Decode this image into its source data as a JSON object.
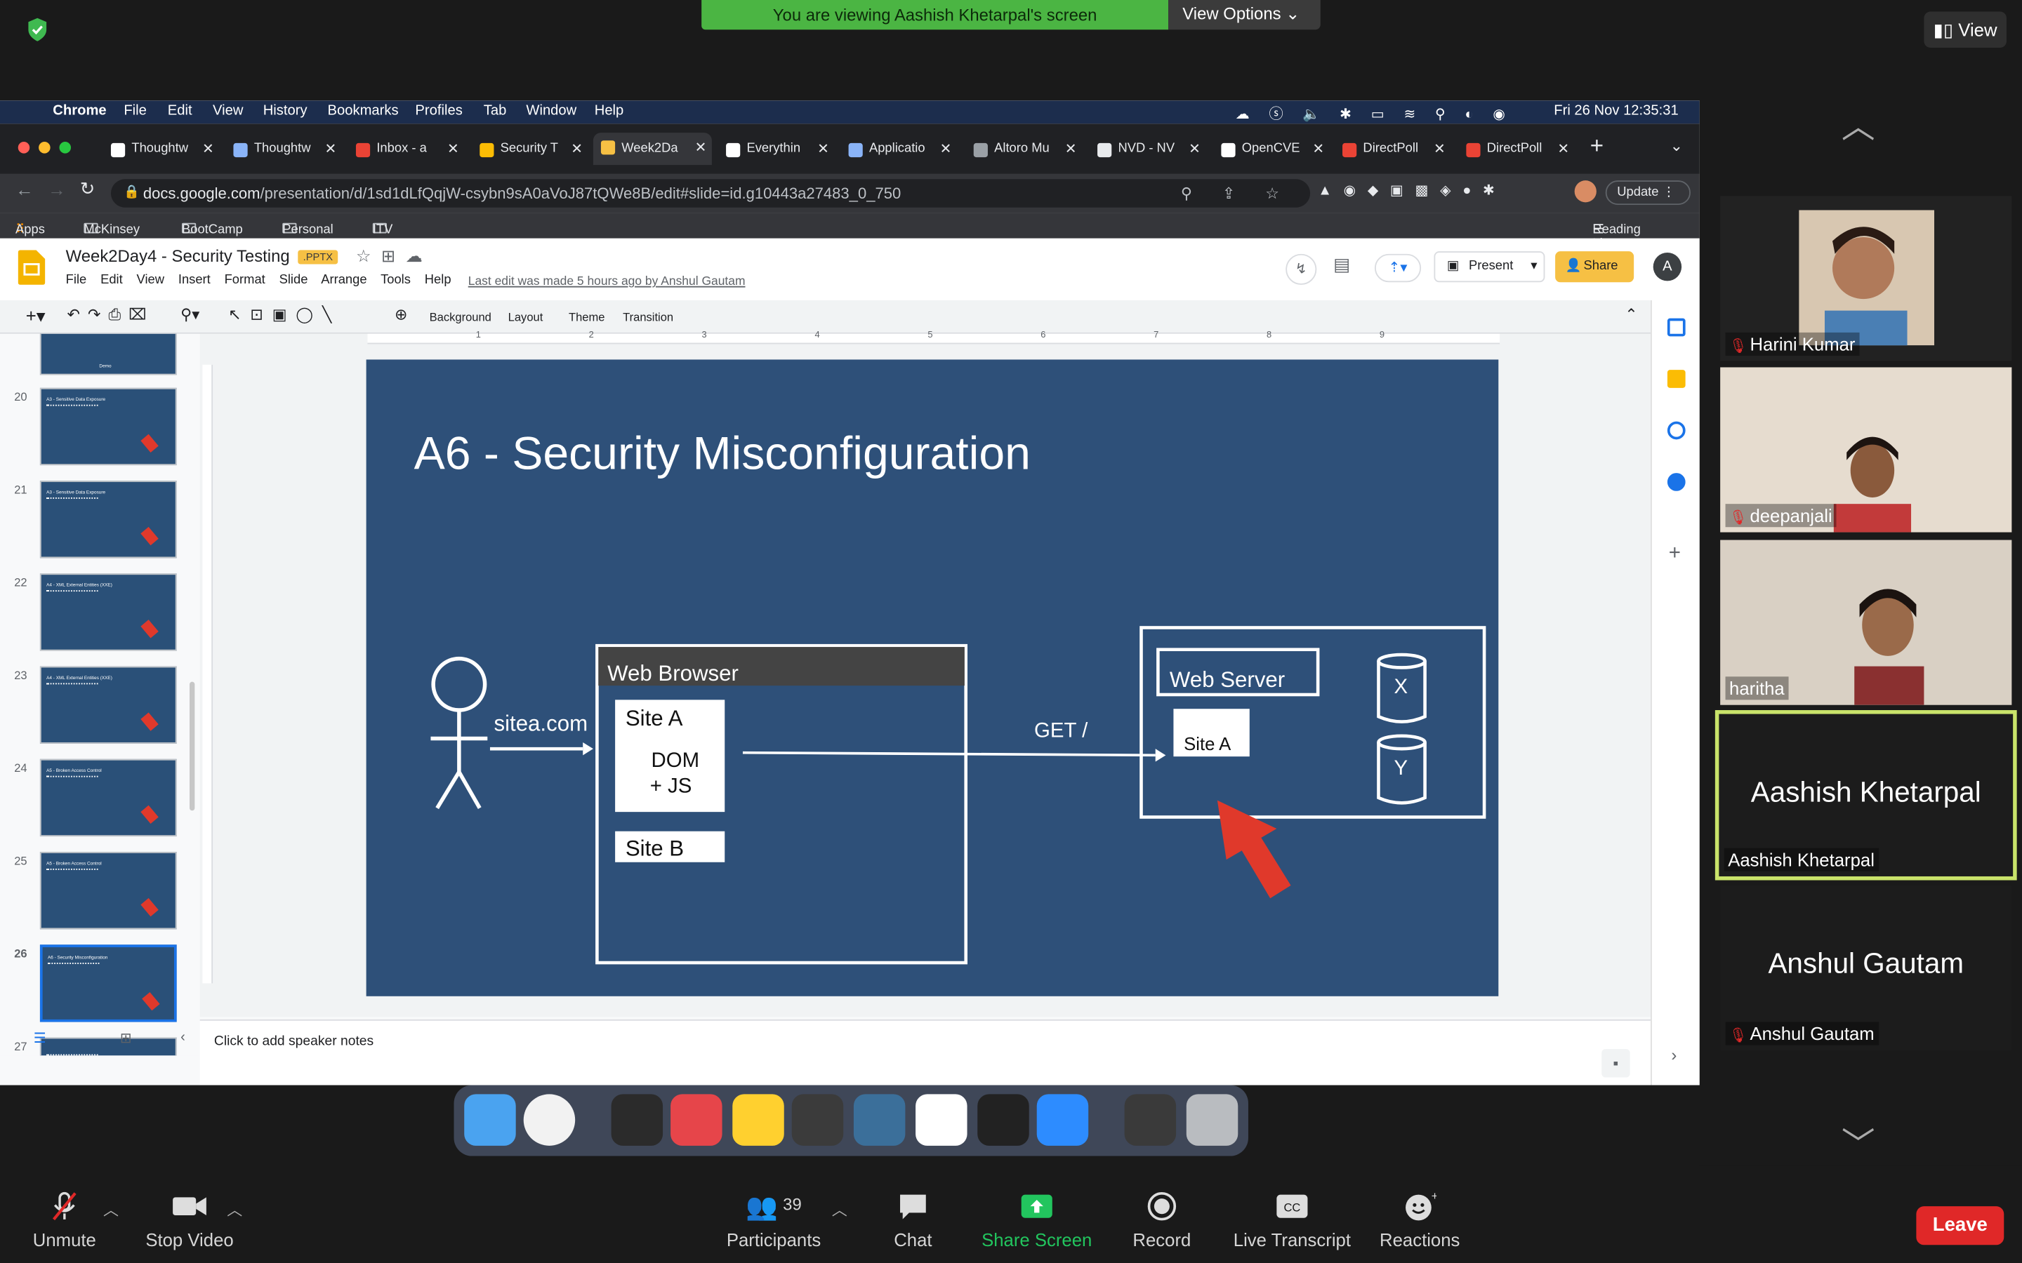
{
  "zoom": {
    "banner": "You are viewing Aashish Khetarpal's screen",
    "view_options": "View Options",
    "view_button": "View",
    "bottom": {
      "unmute": "Unmute",
      "stop_video": "Stop Video",
      "participants": "Participants",
      "participants_count": "39",
      "chat": "Chat",
      "share_screen": "Share Screen",
      "record": "Record",
      "live_transcript": "Live Transcript",
      "reactions": "Reactions",
      "leave": "Leave"
    },
    "participants": [
      {
        "name": "Harini Kumar",
        "muted": true
      },
      {
        "name": "deepanjali",
        "muted": true
      },
      {
        "name": "haritha",
        "muted": false
      },
      {
        "name": "Aashish Khetarpal",
        "muted": false,
        "big": "Aashish Khetarpal",
        "active": true
      },
      {
        "name": "Anshul Gautam",
        "muted": true,
        "big": "Anshul Gautam"
      }
    ]
  },
  "mac_menu": {
    "app": "Chrome",
    "items": [
      "File",
      "Edit",
      "View",
      "History",
      "Bookmarks",
      "Profiles",
      "Tab",
      "Window",
      "Help"
    ],
    "clock": "Fri 26 Nov  12:35:31"
  },
  "chrome": {
    "tabs": [
      {
        "label": "Thoughtw",
        "color": "#ffffff"
      },
      {
        "label": "Thoughtw",
        "color": "#8ab4f8"
      },
      {
        "label": "Inbox - a",
        "color": "#ea4335"
      },
      {
        "label": "Security T",
        "color": "#fbbc04"
      },
      {
        "label": "Week2Da",
        "color": "#f6c044",
        "active": true
      },
      {
        "label": "Everythin",
        "color": "#ffffff"
      },
      {
        "label": "Applicatio",
        "color": "#8ab4f8"
      },
      {
        "label": "Altoro Mu",
        "color": "#9aa0a6"
      },
      {
        "label": "NVD - NV",
        "color": "#e8eaed"
      },
      {
        "label": "OpenCVE",
        "color": "#ffffff"
      },
      {
        "label": "DirectPoll",
        "color": "#ea4335"
      },
      {
        "label": "DirectPoll",
        "color": "#ea4335"
      }
    ],
    "url_host": "docs.google.com",
    "url_path": "/presentation/d/1sd1dLfQqjW-csybn9sA0aVoJ87tQWe8B/edit#slide=id.g10443a27483_0_750",
    "update_btn": "Update",
    "bookmarks": [
      "Apps",
      "McKinsey",
      "BootCamp",
      "Personal",
      "ITV"
    ],
    "reading_list": "Reading List"
  },
  "slides": {
    "title": "Week2Day4 - Security Testing",
    "badge": ".PPTX",
    "menu": [
      "File",
      "Edit",
      "View",
      "Insert",
      "Format",
      "Slide",
      "Arrange",
      "Tools",
      "Help"
    ],
    "last_edit": "Last edit was made 5 hours ago by Anshul Gautam",
    "present": "Present",
    "share": "Share",
    "avatar": "A",
    "toolbar": {
      "background": "Background",
      "layout": "Layout",
      "theme": "Theme",
      "transition": "Transition"
    },
    "thumbs": [
      {
        "num": "20",
        "title": "A3 - Sensitive Data Exposure"
      },
      {
        "num": "21",
        "title": "A3 - Sensitive Data Exposure"
      },
      {
        "num": "22",
        "title": "A4 - XML External Entities (XXE)"
      },
      {
        "num": "23",
        "title": "A4 - XML External Entities (XXE)"
      },
      {
        "num": "24",
        "title": "A5 - Broken Access Control"
      },
      {
        "num": "25",
        "title": "A5 - Broken Access Control"
      },
      {
        "num": "26",
        "title": "A6 - Security Misconfiguration",
        "selected": true
      },
      {
        "num": "27",
        "title": ""
      }
    ],
    "top_thumb_label": "Demo",
    "speaker_notes": "Click to add speaker notes",
    "ruler": [
      "1",
      "2",
      "3",
      "4",
      "5",
      "6",
      "7",
      "8",
      "9"
    ],
    "slide": {
      "title": "A6  - Security Misconfiguration",
      "user_label": "sitea.com",
      "browser": "Web Browser",
      "site_a": "Site A",
      "dom_js_1": "DOM",
      "dom_js_2": "+ JS",
      "site_b": "Site B",
      "get": "GET /",
      "server": "Web Server",
      "server_site": "Site A",
      "db_x": "X",
      "db_y": "Y"
    }
  }
}
